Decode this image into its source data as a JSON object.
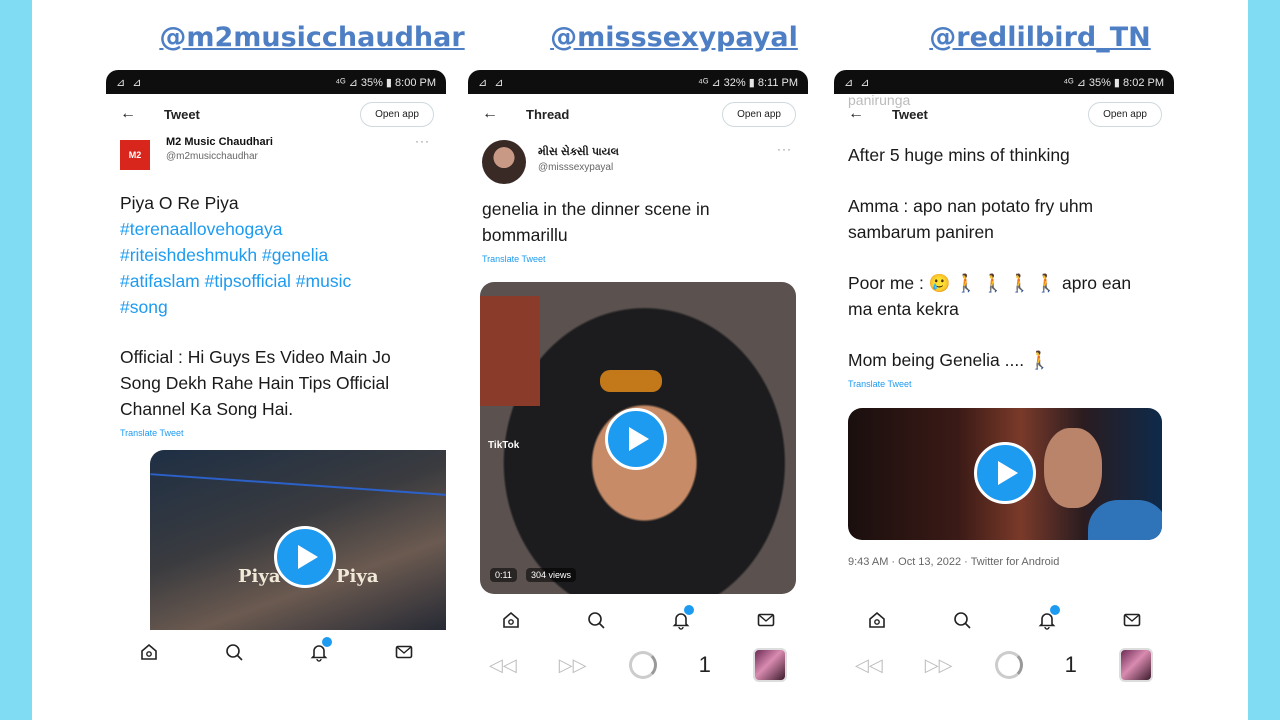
{
  "handles": [
    "@m2musicchaudhar",
    "@misssexypayal",
    "@redlilbird_TN"
  ],
  "phones": [
    {
      "status": {
        "left": "⊿ ⊿",
        "right": "⁴ᴳ ⊿ 35% ▮ 8:00 PM"
      },
      "title": "Tweet",
      "open_app": "Open app",
      "author_name": "M2 Music Chaudhari",
      "author_handle": "@m2musicchaudhar",
      "avatar_text": "M2",
      "tweet": {
        "line1": "Piya O Re Piya",
        "tags": [
          "#terenaallovehogaya",
          "#riteishdeshmukh",
          "#genelia",
          "#atifaslam",
          "#tipsofficial",
          "#music",
          "#song"
        ],
        "body": "Official : Hi Guys Es Video Main Jo Song Dekh Rahe Hain Tips Official Channel Ka Song Hai."
      },
      "translate": "Translate Tweet",
      "video_caption_left": "Piya",
      "video_caption_right": "Piya"
    },
    {
      "status": {
        "left": "⊿ ⊿",
        "right": "⁴ᴳ ⊿ 32% ▮ 8:11 PM"
      },
      "title": "Thread",
      "open_app": "Open app",
      "author_name": "મીસ સેક્સી પાયલ",
      "author_handle": "@misssexypayal",
      "tweet": {
        "body": "genelia in the dinner scene in bommarillu"
      },
      "translate": "Translate Tweet",
      "video_overlay_app": "TikTok",
      "video_duration": "0:11",
      "video_views": "304 views"
    },
    {
      "status": {
        "left": "⊿ ⊿",
        "right": "⁴ᴳ ⊿ 35% ▮ 8:02 PM"
      },
      "title": "Tweet",
      "ghost_text": "panirunga",
      "open_app": "Open app",
      "tweet": {
        "p1": "After 5 huge mins of thinking",
        "p2": "Amma : apo nan potato fry uhm sambarum paniren",
        "p3": "Poor me : 🥲 🚶 🚶 🚶 🚶 apro ean ma enta kekra",
        "p4": "Mom being  Genelia .... 🚶"
      },
      "translate": "Translate Tweet",
      "meta": "9:43 AM · Oct 13, 2022 · Twitter for Android"
    }
  ],
  "browser": {
    "tab_count": "1",
    "back": "◁◁",
    "forward": "▷▷"
  }
}
